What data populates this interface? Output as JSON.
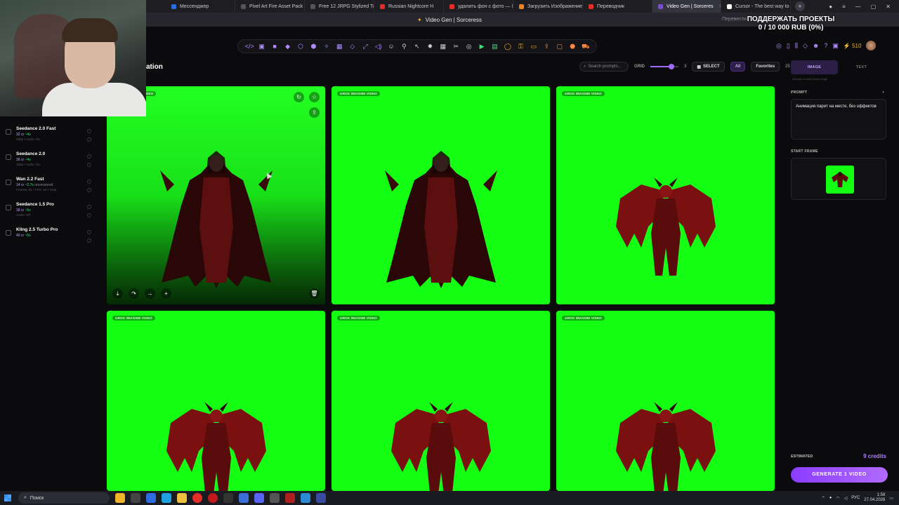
{
  "browser": {
    "tabs": [
      {
        "label": "Мессенджер",
        "color": "#2d6cdf"
      },
      {
        "label": "Pixel Art Fire Asset Pack",
        "color": "#555555"
      },
      {
        "label": "Free 12 JRPG Stylized Tra",
        "color": "#555555"
      },
      {
        "label": "Russian Nightcore H",
        "color": "#e52d27"
      },
      {
        "label": "удалить фон с фото — Ян",
        "color": "#e52d27"
      },
      {
        "label": "Загрузить Изображение",
        "color": "#f08020"
      },
      {
        "label": "Переводчик",
        "color": "#e52d27"
      },
      {
        "label": "Video Gen | Sorceres",
        "color": "#7a4dd8"
      },
      {
        "label": "Cursor - The best way to c",
        "color": "#ffffff"
      }
    ],
    "new_tab": "+",
    "page_title": "Video Gen | Sorceress",
    "overlay_translate": "Перевести",
    "support_line1": "ПОДДЕРЖАТЬ ПРОЕКТЫ",
    "support_line2": "0 / 10 000 RUB (0%)"
  },
  "app": {
    "title_fragment": "ation",
    "credits": "510",
    "controls": {
      "search_placeholder": "Search prompts...",
      "grid_label": "GRID",
      "grid_value": "3",
      "grid_fraction": 0.75,
      "select_label": "SELECT",
      "all_label": "All",
      "favorites_label": "Favorites",
      "count": "25"
    },
    "toolbar_icons": [
      "code-icon",
      "image-icon",
      "video-icon",
      "gem-icon",
      "sprite-icon",
      "layers-icon",
      "wand-icon",
      "grid-icon",
      "eraser-icon",
      "expand-icon",
      "audio-icon",
      "robot-icon",
      "figure-icon",
      "cursor-icon",
      "bug-icon",
      "tiles-icon",
      "scissors-icon",
      "web-icon",
      "play-icon",
      "sheet-icon",
      "chat-icon",
      "key-icon",
      "folder-icon",
      "export-icon",
      "box-icon",
      "cube-icon",
      "cart-icon"
    ]
  },
  "models": [
    {
      "name": "Seedance 2.0 Fast",
      "cost": "32 cr",
      "tag": "~4s",
      "sub": "480p • Audio: On"
    },
    {
      "name": "Seedance 2.0",
      "cost": "36 cr",
      "tag": "~4s",
      "sub": "480p • Audio: On"
    },
    {
      "name": "Wan 2.2 Fast",
      "cost": "14 cr",
      "tag": "~2.7s",
      "extra": "uncensored",
      "sub": "Frames: 81 • FPS: 16 • 720p"
    },
    {
      "name": "Seedance 1.5 Pro",
      "cost": "18 cr",
      "tag": "~5s",
      "sub": "Audio: Off"
    },
    {
      "name": "Kling 2.5 Turbo Pro",
      "cost": "40 cr",
      "tag": "~5s",
      "sub": ""
    }
  ],
  "cards": [
    {
      "badge": "GROK IMAGINE VIDEO",
      "subject": "vampire",
      "dark": true
    },
    {
      "badge": "GROK IMAGINE VIDEO",
      "subject": "vampire",
      "dark": false
    },
    {
      "badge": "GROK IMAGINE VIDEO",
      "subject": "demon",
      "dark": false
    },
    {
      "badge": "GROK IMAGINE VIDEO",
      "subject": "demon",
      "dark": false
    },
    {
      "badge": "GROK IMAGINE VIDEO",
      "subject": "demon",
      "dark": false
    },
    {
      "badge": "GROK IMAGINE VIDEO",
      "subject": "demon",
      "dark": false
    }
  ],
  "first_card_badge_visible": "DEO",
  "panel": {
    "tab_image": "IMAGE",
    "tab_text": "TEXT",
    "hint": "Animate a start frame image",
    "prompt_label": "PROMPT",
    "prompt_text": "Анимация парит на месте, без эффектов",
    "start_frame_label": "START FRAME",
    "estimated_label": "ESTIMATED",
    "estimated_value": "9 credits",
    "generate_label": "GENERATE 1 VIDEO"
  },
  "taskbar": {
    "search_label": "Поиск",
    "lang": "РУС",
    "time": "1:58",
    "date": "27.04.2026"
  }
}
